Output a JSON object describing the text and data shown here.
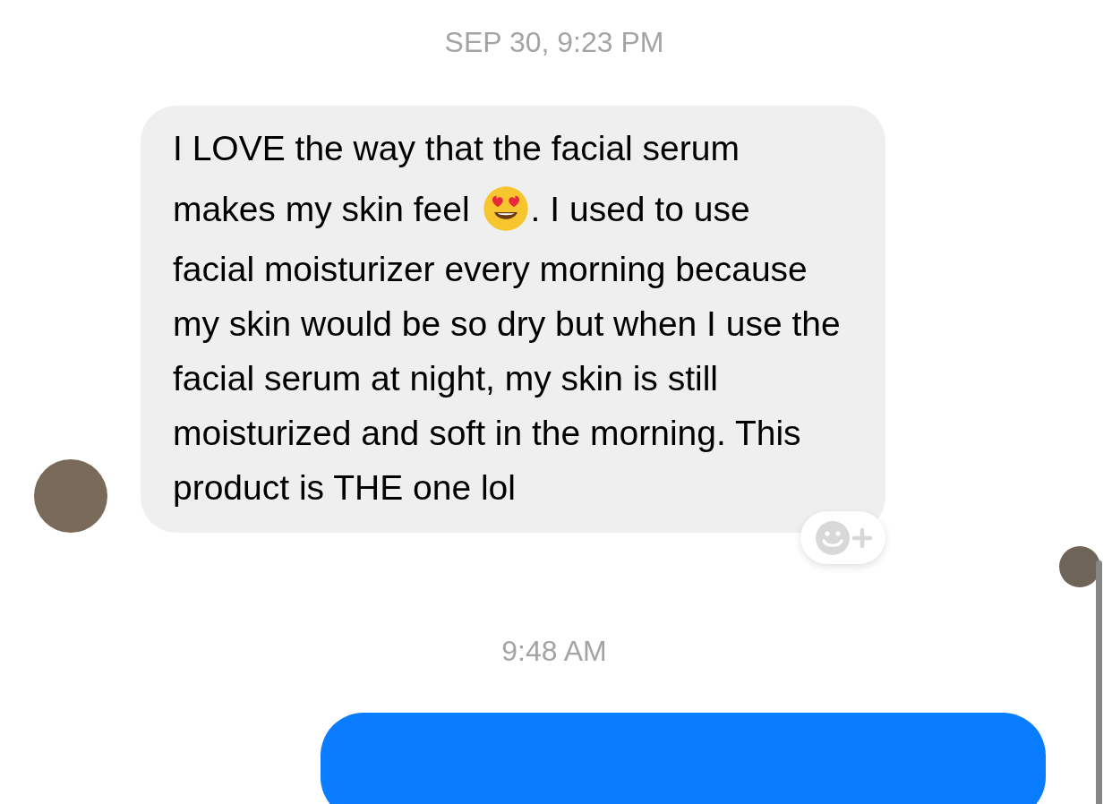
{
  "thread": [
    {
      "kind": "timestamp",
      "text": "SEP 30, 9:23 PM"
    },
    {
      "kind": "incoming",
      "line_1": "I LOVE the way that the facial serum",
      "text_before_emoji": "makes my skin feel",
      "text_after_emoji": ". I used to use",
      "rest": "facial moisturizer every morning because my skin would be so dry but when I use the facial serum at night, my skin is still moisturized and soft in the morning. This product is THE one lol"
    },
    {
      "kind": "timestamp",
      "text": "9:48 AM"
    },
    {
      "kind": "outgoing"
    }
  ]
}
